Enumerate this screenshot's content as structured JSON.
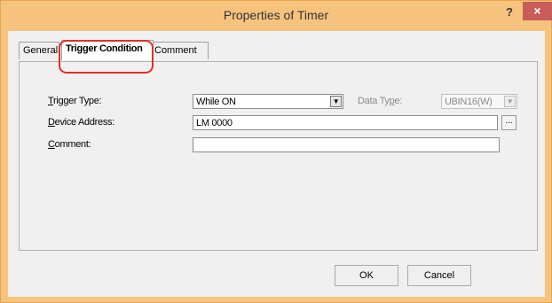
{
  "window": {
    "title": "Properties of Timer",
    "help_label": "?",
    "close_label": "×"
  },
  "tabs": [
    {
      "label": "General"
    },
    {
      "label": "Trigger Condition",
      "selected": true
    },
    {
      "label": "Comment"
    }
  ],
  "form": {
    "trigger_type": {
      "label_u": "T",
      "label_rest": "rigger Type:",
      "value": "While ON"
    },
    "data_type": {
      "label_pre": "Data Ty",
      "label_u": "p",
      "label_rest": "e:",
      "value": "UBIN16(W)"
    },
    "device_address": {
      "label_u": "D",
      "label_rest": "evice Address:",
      "value": "LM 0000",
      "browse_label": "..."
    },
    "comment": {
      "label_u": "C",
      "label_rest": "omment:",
      "value": ""
    }
  },
  "buttons": {
    "ok": "OK",
    "cancel": "Cancel"
  },
  "colors": {
    "titlebar": "#f6c37f",
    "close_button": "#c85c59",
    "highlight": "#e0302a",
    "dialog_bg": "#f0f0f0"
  },
  "icons": {
    "dropdown": "chevron-down-icon",
    "help": "help-icon",
    "close": "close-icon"
  }
}
